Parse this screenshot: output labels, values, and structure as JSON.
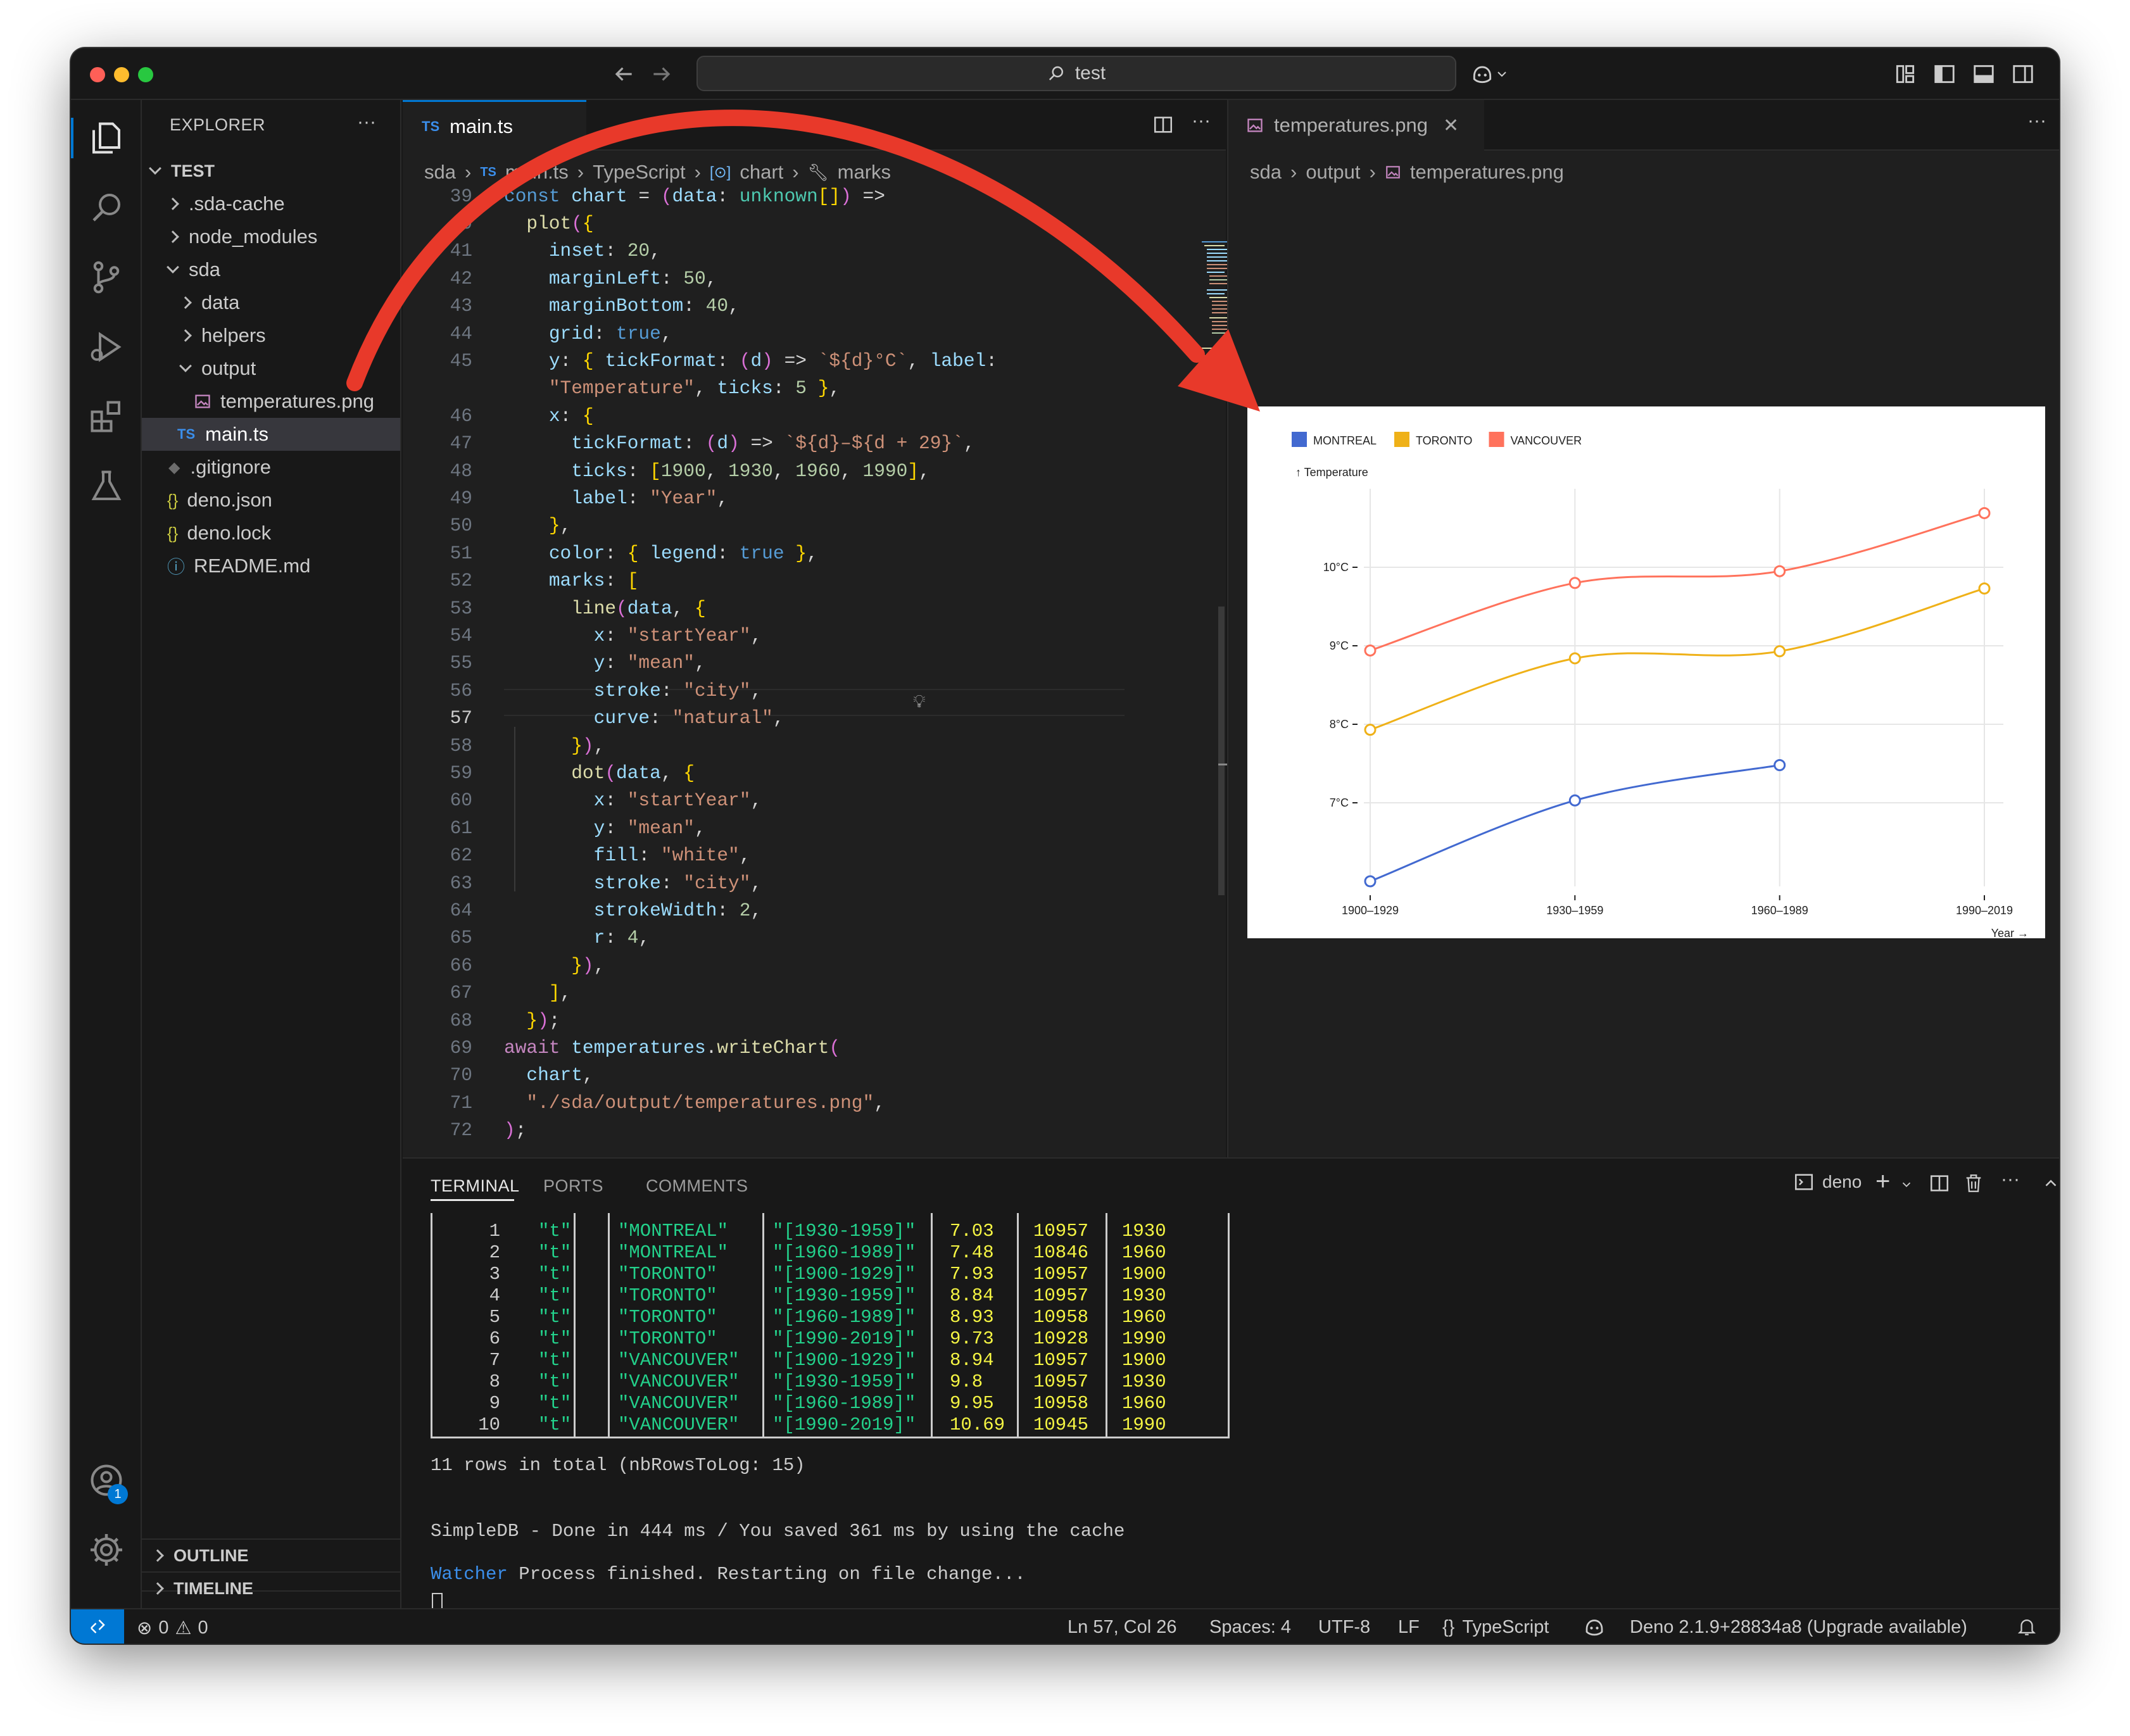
{
  "window": {
    "search_text": "test"
  },
  "sidebar": {
    "title": "EXPLORER",
    "more": "···",
    "root": "TEST",
    "items": [
      {
        "label": ".sda-cache"
      },
      {
        "label": "node_modules"
      },
      {
        "label": "sda"
      },
      {
        "label": "data"
      },
      {
        "label": "helpers"
      },
      {
        "label": "output"
      },
      {
        "label": "temperatures.png"
      },
      {
        "label": "main.ts"
      },
      {
        "label": ".gitignore"
      },
      {
        "label": "deno.json"
      },
      {
        "label": "deno.lock"
      },
      {
        "label": "README.md"
      }
    ],
    "outline": "OUTLINE",
    "timeline": "TIMELINE",
    "accounts_badge": "1"
  },
  "editor": {
    "tab_prefix": "TS",
    "tab": "main.ts",
    "breadcrumb": [
      "sda",
      "main.ts",
      "TypeScript",
      "chart",
      "marks"
    ],
    "code_lines": [
      {
        "n": "39",
        "text": "const chart = (data: unknown[]) =>"
      },
      {
        "n": "40",
        "text": "  plot({"
      },
      {
        "n": "41",
        "text": "    inset: 20,"
      },
      {
        "n": "42",
        "text": "    marginLeft: 50,"
      },
      {
        "n": "43",
        "text": "    marginBottom: 40,"
      },
      {
        "n": "44",
        "text": "    grid: true,"
      },
      {
        "n": "45",
        "text": "    y: { tickFormat: (d) => `${d}°C`, label:"
      },
      {
        "n": "",
        "text": "    \"Temperature\", ticks: 5 },"
      },
      {
        "n": "46",
        "text": "    x: {"
      },
      {
        "n": "47",
        "text": "      tickFormat: (d) => `${d}–${d + 29}`,"
      },
      {
        "n": "48",
        "text": "      ticks: [1900, 1930, 1960, 1990],"
      },
      {
        "n": "49",
        "text": "      label: \"Year\","
      },
      {
        "n": "50",
        "text": "    },"
      },
      {
        "n": "51",
        "text": "    color: { legend: true },"
      },
      {
        "n": "52",
        "text": "    marks: ["
      },
      {
        "n": "53",
        "text": "      line(data, {"
      },
      {
        "n": "54",
        "text": "        x: \"startYear\","
      },
      {
        "n": "55",
        "text": "        y: \"mean\","
      },
      {
        "n": "56",
        "text": "        stroke: \"city\","
      },
      {
        "n": "57",
        "text": "        curve: \"natural\","
      },
      {
        "n": "58",
        "text": "      }),"
      },
      {
        "n": "59",
        "text": "      dot(data, {"
      },
      {
        "n": "60",
        "text": "        x: \"startYear\","
      },
      {
        "n": "61",
        "text": "        y: \"mean\","
      },
      {
        "n": "62",
        "text": "        fill: \"white\","
      },
      {
        "n": "63",
        "text": "        stroke: \"city\","
      },
      {
        "n": "64",
        "text": "        strokeWidth: 2,"
      },
      {
        "n": "65",
        "text": "        r: 4,"
      },
      {
        "n": "66",
        "text": "      }),"
      },
      {
        "n": "67",
        "text": "    ],"
      },
      {
        "n": "68",
        "text": "  });"
      },
      {
        "n": "69",
        "text": "await temperatures.writeChart("
      },
      {
        "n": "70",
        "text": "  chart,"
      },
      {
        "n": "71",
        "text": "  \"./sda/output/temperatures.png\","
      },
      {
        "n": "72",
        "text": ");"
      }
    ]
  },
  "image_pane": {
    "tab": "temperatures.png",
    "breadcrumb": [
      "sda",
      "output",
      "temperatures.png"
    ]
  },
  "chart_data": {
    "type": "line",
    "legend": [
      "MONTREAL",
      "TORONTO",
      "VANCOUVER"
    ],
    "ylabel": "↑ Temperature",
    "xlabel": "Year →",
    "categories": [
      "1900–1929",
      "1930–1959",
      "1960–1989",
      "1990–2019"
    ],
    "y_ticks": [
      "7°C",
      "8°C",
      "9°C",
      "10°C"
    ],
    "ylim": [
      6.0,
      11.0
    ],
    "grid": true,
    "series": [
      {
        "name": "MONTREAL",
        "color": "#4269d0",
        "values": [
          6.0,
          7.03,
          7.48,
          null
        ]
      },
      {
        "name": "TORONTO",
        "color": "#efb118",
        "values": [
          7.93,
          8.84,
          8.93,
          9.73
        ]
      },
      {
        "name": "VANCOUVER",
        "color": "#ff725c",
        "values": [
          8.94,
          9.8,
          9.95,
          10.69
        ]
      }
    ]
  },
  "panel": {
    "tabs": [
      "TERMINAL",
      "PORTS",
      "COMMENTS"
    ],
    "terminal_name": "deno",
    "rows": [
      [
        "1",
        "\"t\"",
        "\"MONTREAL\"",
        "\"[1930-1959]\"",
        "7.03",
        "10957",
        "1930"
      ],
      [
        "2",
        "\"t\"",
        "\"MONTREAL\"",
        "\"[1960-1989]\"",
        "7.48",
        "10846",
        "1960"
      ],
      [
        "3",
        "\"t\"",
        "\"TORONTO\"",
        "\"[1900-1929]\"",
        "7.93",
        "10957",
        "1900"
      ],
      [
        "4",
        "\"t\"",
        "\"TORONTO\"",
        "\"[1930-1959]\"",
        "8.84",
        "10957",
        "1930"
      ],
      [
        "5",
        "\"t\"",
        "\"TORONTO\"",
        "\"[1960-1989]\"",
        "8.93",
        "10958",
        "1960"
      ],
      [
        "6",
        "\"t\"",
        "\"TORONTO\"",
        "\"[1990-2019]\"",
        "9.73",
        "10928",
        "1990"
      ],
      [
        "7",
        "\"t\"",
        "\"VANCOUVER\"",
        "\"[1900-1929]\"",
        "8.94",
        "10957",
        "1900"
      ],
      [
        "8",
        "\"t\"",
        "\"VANCOUVER\"",
        "\"[1930-1959]\"",
        "9.8",
        "10957",
        "1930"
      ],
      [
        "9",
        "\"t\"",
        "\"VANCOUVER\"",
        "\"[1960-1989]\"",
        "9.95",
        "10958",
        "1960"
      ],
      [
        "10",
        "\"t\"",
        "\"VANCOUVER\"",
        "\"[1990-2019]\"",
        "10.69",
        "10945",
        "1990"
      ]
    ],
    "total": "11 rows in total (nbRowsToLog: 15)",
    "done": "SimpleDB - Done in 444 ms / You saved 361 ms by using the cache",
    "watcher_label": "Watcher",
    "watcher_msg": "Process finished. Restarting on file change..."
  },
  "status": {
    "errors": "0",
    "warnings": "0",
    "position": "Ln 57, Col 26",
    "spaces": "Spaces: 4",
    "encoding": "UTF-8",
    "eol": "LF",
    "language": "TypeScript",
    "deno": "Deno 2.1.9+28834a8 (Upgrade available)"
  }
}
